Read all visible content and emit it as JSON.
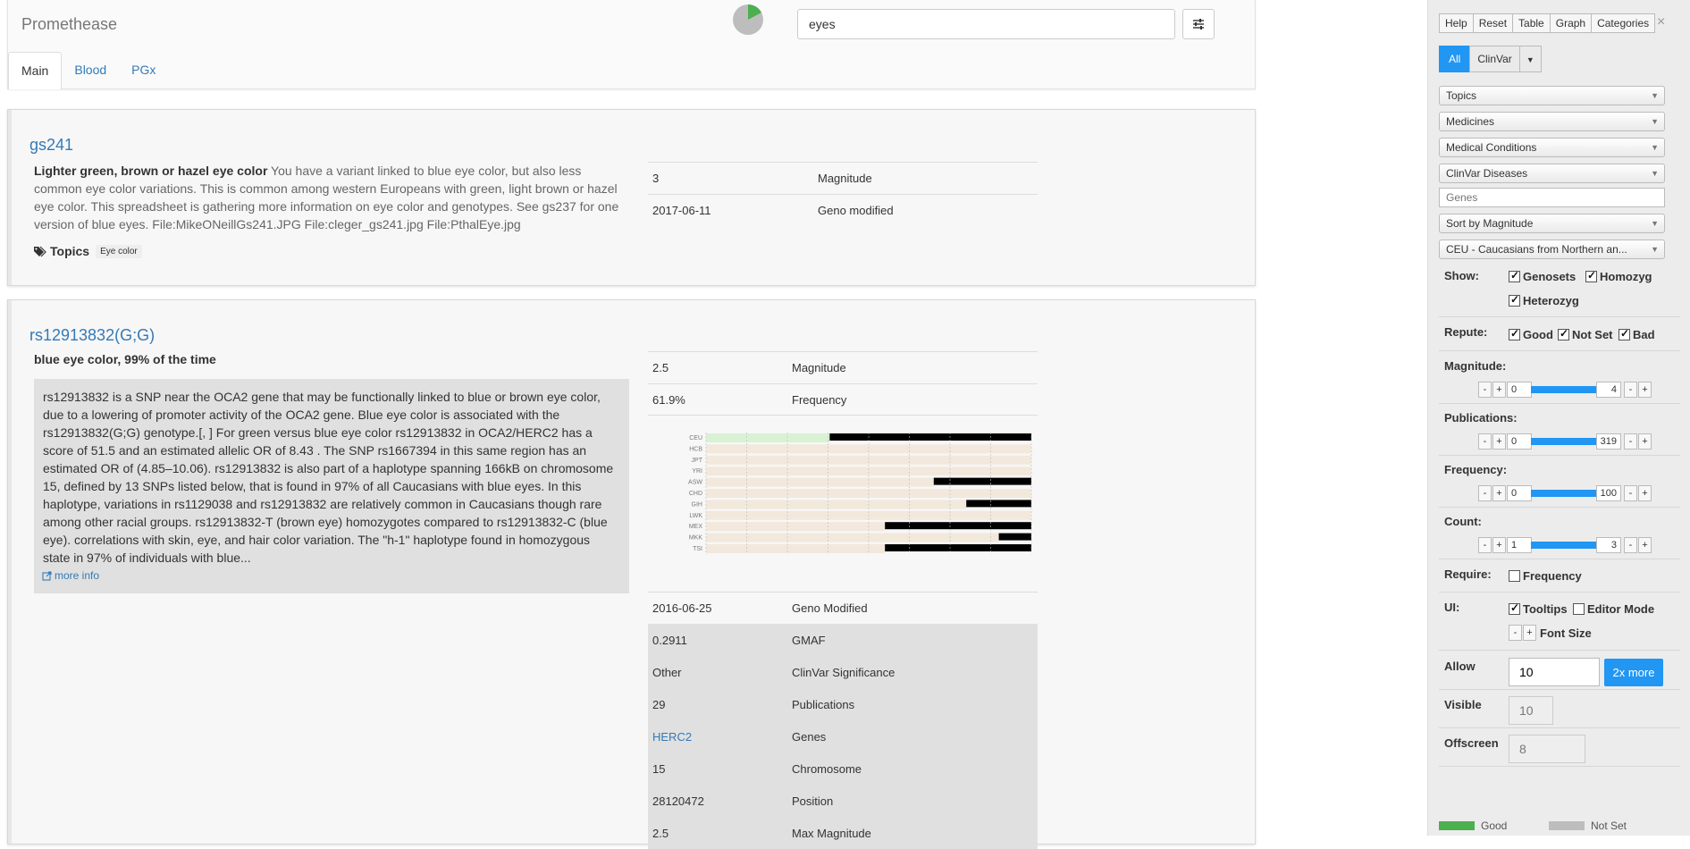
{
  "app": {
    "title": "Promethease"
  },
  "search": {
    "value": "eyes"
  },
  "tabs": [
    {
      "label": "Main",
      "active": true
    },
    {
      "label": "Blood"
    },
    {
      "label": "PGx"
    }
  ],
  "cards": {
    "gs241": {
      "title": "gs241",
      "lead": "Lighter green, brown or hazel eye color",
      "description": " You have a variant linked to blue eye color, but also less common eye color variations. This is common among western Europeans with green, light brown or hazel eye color. This spreadsheet is gathering more information on eye color and genotypes. See gs237 for one version of blue eyes. File:MikeONeillGs241.JPG File:cleger_gs241.jpg File:PthalEye.jpg",
      "topics_label": "Topics",
      "topic": "Eye color",
      "rows": [
        {
          "value": "3",
          "label": "Magnitude"
        },
        {
          "value": "2017-06-11",
          "label": "Geno modified"
        }
      ]
    },
    "rs": {
      "title": "rs12913832(G;G)",
      "subtitle": "blue eye color, 99% of the time",
      "description": "rs12913832 is a SNP near the OCA2 gene that may be functionally linked to blue or brown eye color, due to a lowering of promoter activity of the OCA2 gene. Blue eye color is associated with the rs12913832(G;G) genotype.[, ] For green versus blue eye color rs12913832 in OCA2/HERC2 has a score of 51.5 and an estimated allelic OR of 8.43 . The SNP rs1667394 in this same region has an estimated OR of (4.85–10.06). rs12913832 is also part of a haplotype spanning 166kB on chromosome 15, defined by 13 SNPs listed below, that is found in 97% of all Caucasians with blue eyes. In this haplotype, variations in rs1129038 and rs12913832 are relatively common in Caucasians though rare among other racial groups. rs12913832-T (brown eye) homozygotes compared to rs12913832-C (blue eye). correlations with skin, eye, and hair color variation. The \"h-1\" haplotype found in homozygous state in 97% of individuals with blue...",
      "more_info": "more info",
      "top_rows": [
        {
          "value": "2.5",
          "label": "Magnitude"
        },
        {
          "value": "61.9%",
          "label": "Frequency"
        }
      ],
      "bottom_rows": [
        {
          "value": "2016-06-25",
          "label": "Geno Modified",
          "grey": false
        },
        {
          "value": "0.2911",
          "label": "GMAF",
          "grey": true
        },
        {
          "value": "Other",
          "label": "ClinVar Significance",
          "grey": true
        },
        {
          "value": "29",
          "label": "Publications",
          "grey": true
        },
        {
          "value": "HERC2",
          "label": "Genes",
          "grey": true,
          "link": true
        },
        {
          "value": "15",
          "label": "Chromosome",
          "grey": true
        },
        {
          "value": "28120472",
          "label": "Position",
          "grey": true
        },
        {
          "value": "2.5",
          "label": "Max Magnitude",
          "grey": true
        }
      ],
      "freq_chart": {
        "populations": [
          "CEU",
          "HCB",
          "JPT",
          "YRI",
          "ASW",
          "CHD",
          "GIH",
          "LWK",
          "MEX",
          "MKK",
          "TSI"
        ],
        "x_ticks": [
          "0",
          "12.5",
          "25",
          "37.5",
          "50",
          "62.5",
          "75",
          "87.5",
          "100"
        ],
        "colors": {
          "aa": "#d9f2d4",
          "ab": "#f2e8dc",
          "bb": "#000000"
        },
        "rows": [
          {
            "aa": 38,
            "ab": 0,
            "bb": 62
          },
          {
            "aa": 0,
            "ab": 100,
            "bb": 0
          },
          {
            "aa": 0,
            "ab": 100,
            "bb": 0
          },
          {
            "aa": 0,
            "ab": 100,
            "bb": 0
          },
          {
            "aa": 0,
            "ab": 70,
            "bb": 30
          },
          {
            "aa": 0,
            "ab": 100,
            "bb": 0
          },
          {
            "aa": 0,
            "ab": 80,
            "bb": 20
          },
          {
            "aa": 0,
            "ab": 100,
            "bb": 0
          },
          {
            "aa": 0,
            "ab": 55,
            "bb": 45
          },
          {
            "aa": 0,
            "ab": 90,
            "bb": 10
          },
          {
            "aa": 0,
            "ab": 55,
            "bb": 45
          }
        ]
      }
    }
  },
  "side": {
    "top_buttons": [
      "Help",
      "Reset",
      "Table",
      "Graph",
      "Categories"
    ],
    "close": "×",
    "filter_all": "All",
    "filter_clinvar": "ClinVar",
    "dropdowns": {
      "topics": "Topics",
      "medicines": "Medicines",
      "conditions": "Medical Conditions",
      "clinvar": "ClinVar Diseases",
      "sort": "Sort by Magnitude",
      "population": "CEU - Caucasians from Northern an..."
    },
    "genes_placeholder": "Genes",
    "show": {
      "label": "Show:",
      "genosets": "Genosets",
      "homozyg": "Homozyg",
      "heterozyg": "Heterozyg"
    },
    "repute": {
      "label": "Repute:",
      "good": "Good",
      "notset": "Not Set",
      "bad": "Bad"
    },
    "magnitude": {
      "label": "Magnitude:",
      "min": "0",
      "max": "4"
    },
    "publications": {
      "label": "Publications:",
      "min": "0",
      "max": "319"
    },
    "frequency": {
      "label": "Frequency:",
      "min": "0",
      "max": "100"
    },
    "count": {
      "label": "Count:",
      "min": "1",
      "max": "3"
    },
    "require": {
      "label": "Require:",
      "frequency": "Frequency"
    },
    "ui": {
      "label": "UI:",
      "tooltips": "Tooltips",
      "editor": "Editor Mode",
      "fontsize": "Font Size"
    },
    "allow": {
      "label": "Allow",
      "value": "10",
      "more": "2x more"
    },
    "visible": {
      "label": "Visible",
      "value": "10"
    },
    "offscreen": {
      "label": "Offscreen",
      "value": "8"
    },
    "legend": {
      "good": "Good",
      "notset": "Not Set",
      "good_color": "#4caf50",
      "notset_color": "#bdbdbd"
    }
  }
}
